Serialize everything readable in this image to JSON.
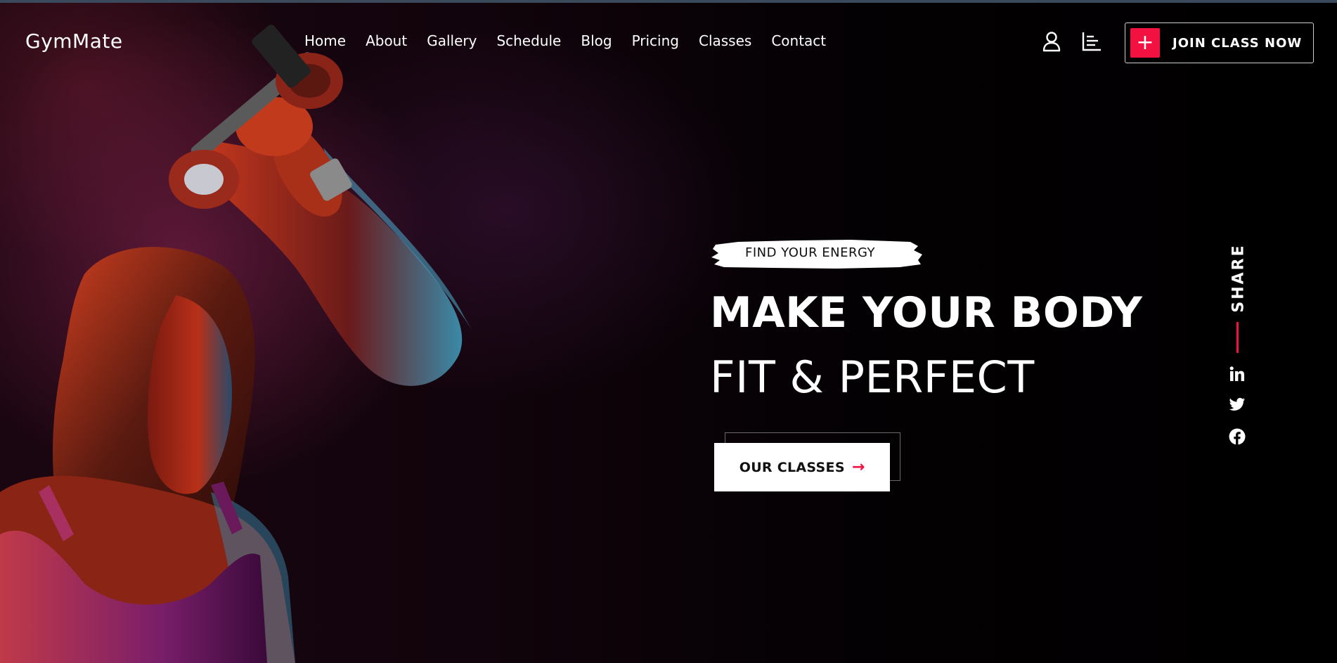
{
  "brand": {
    "name": "GymMate"
  },
  "nav": {
    "items": [
      "Home",
      "About",
      "Gallery",
      "Schedule",
      "Blog",
      "Pricing",
      "Classes",
      "Contact"
    ]
  },
  "header": {
    "user_icon": "user-icon",
    "menu_icon": "bar-lines-icon",
    "join_button": {
      "label": "JOIN CLASS NOW",
      "icon": "plus-icon"
    }
  },
  "hero": {
    "tagline": "FIND YOUR ENERGY",
    "headline": "MAKE YOUR BODY",
    "subheadline": "FIT & PERFECT",
    "cta": {
      "label": "OUR CLASSES",
      "icon": "arrow-right-icon"
    }
  },
  "share": {
    "label": "SHARE",
    "links": [
      "linkedin-icon",
      "twitter-icon",
      "facebook-icon"
    ]
  },
  "colors": {
    "accent": "#f21140",
    "background": "#000000",
    "text": "#ffffff"
  }
}
